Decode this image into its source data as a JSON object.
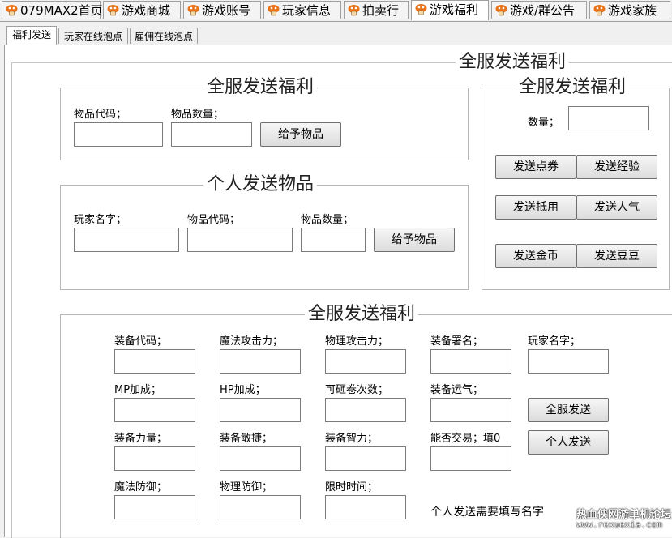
{
  "top_tabs": [
    {
      "label": "079MAX2首页"
    },
    {
      "label": "游戏商城"
    },
    {
      "label": "游戏账号"
    },
    {
      "label": "玩家信息"
    },
    {
      "label": "拍卖行"
    },
    {
      "label": "游戏福利"
    },
    {
      "label": "游戏/群公告"
    },
    {
      "label": "游戏家族"
    }
  ],
  "sub_tabs": [
    {
      "label": "福利发送"
    },
    {
      "label": "玩家在线泡点"
    },
    {
      "label": "雇佣在线泡点"
    }
  ],
  "outer_title": "全服发送福利",
  "box1": {
    "title": "全服发送福利",
    "item_code_label": "物品代码；",
    "item_qty_label": "物品数量；",
    "give_button": "给予物品"
  },
  "box2": {
    "title": "个人发送物品",
    "player_label": "玩家名字；",
    "item_code_label": "物品代码；",
    "item_qty_label": "物品数量；",
    "give_button": "给予物品"
  },
  "box3": {
    "title": "全服发送福利",
    "qty_label": "数量；",
    "buttons": [
      "发送点券",
      "发送经验",
      "发送抵用",
      "发送人气",
      "发送金币",
      "发送豆豆"
    ]
  },
  "box4": {
    "title": "全服发送福利",
    "labels": [
      "装备代码；",
      "魔法攻击力；",
      "物理攻击力；",
      "装备署名；",
      "玩家名字；",
      "MP加成；",
      "HP加成；",
      "可砸卷次数；",
      "装备运气；",
      "装备力量；",
      "装备敏捷；",
      "装备智力；",
      "能否交易；填0",
      "魔法防御；",
      "物理防御；",
      "限时时间；"
    ],
    "all_send_button": "全服发送",
    "personal_send_button": "个人发送",
    "note": "个人发送需要填写名字"
  },
  "watermark": {
    "line1": "热血侠网游单机论坛",
    "line2": "www.rexuexia.com"
  }
}
